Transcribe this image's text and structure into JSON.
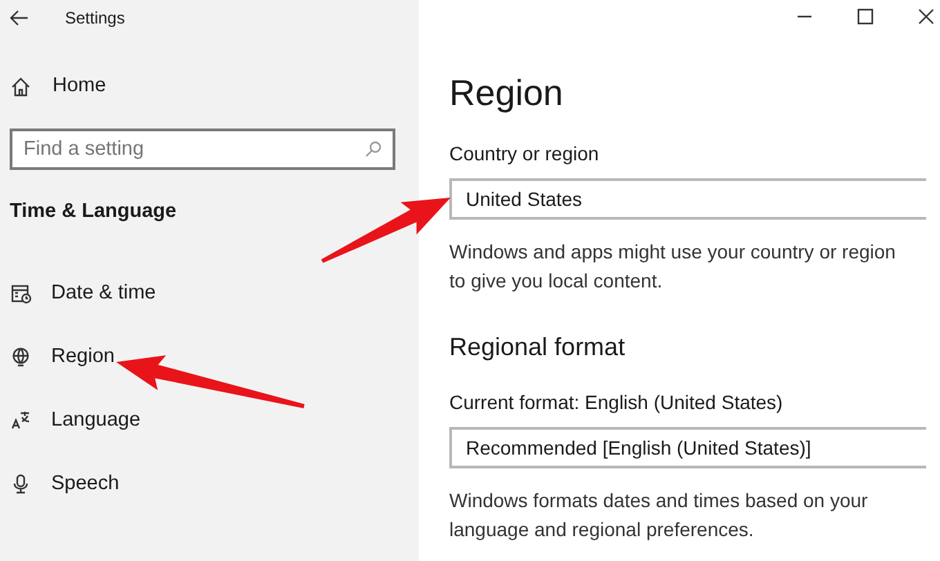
{
  "window": {
    "title": "Settings"
  },
  "sidebar": {
    "home": "Home",
    "search": {
      "placeholder": "Find a setting"
    },
    "section_title": "Time & Language",
    "items": [
      {
        "label": "Date & time"
      },
      {
        "label": "Region"
      },
      {
        "label": "Language"
      },
      {
        "label": "Speech"
      }
    ]
  },
  "content": {
    "title": "Region",
    "country": {
      "label": "Country or region",
      "value": "United States",
      "description": "Windows and apps might use your country or region to give you local content."
    },
    "regional_format": {
      "heading": "Regional format",
      "label": "Current format: English (United States)",
      "value": "Recommended [English (United States)]",
      "description": "Windows formats dates and times based on your language and regional preferences."
    }
  }
}
